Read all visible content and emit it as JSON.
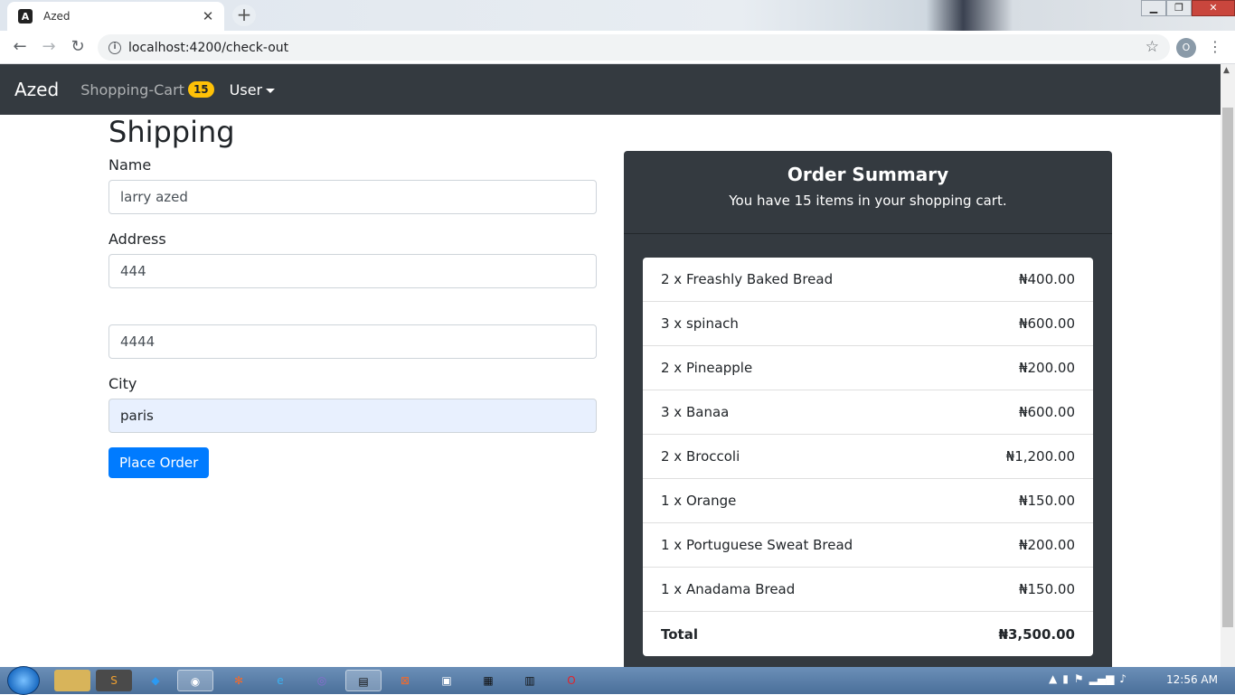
{
  "browser": {
    "tab_title": "Azed",
    "favicon_letter": "A",
    "tab_close": "✕",
    "new_tab": "+",
    "url": "localhost:4200/check-out",
    "profile_initial": "O"
  },
  "navbar": {
    "brand": "Azed",
    "cart_label": "Shopping-Cart",
    "cart_count": "15",
    "user_label": "User"
  },
  "form": {
    "heading": "Shipping",
    "name_label": "Name",
    "name_value": "larry azed",
    "address_label": "Address",
    "address_line1": "444",
    "address_line2": "4444",
    "city_label": "City",
    "city_value": "paris",
    "submit_label": "Place Order"
  },
  "summary": {
    "title": "Order Summary",
    "subtitle": "You have 15 items in your shopping cart.",
    "items": [
      {
        "label": "2 x Freashly Baked Bread",
        "price": "₦400.00"
      },
      {
        "label": "3 x spinach",
        "price": "₦600.00"
      },
      {
        "label": "2 x Pineapple",
        "price": "₦200.00"
      },
      {
        "label": "3 x Banaa",
        "price": "₦600.00"
      },
      {
        "label": "2 x Broccoli",
        "price": "₦1,200.00"
      },
      {
        "label": "1 x Orange",
        "price": "₦150.00"
      },
      {
        "label": "1 x Portuguese Sweat Bread",
        "price": "₦200.00"
      },
      {
        "label": "1 x Anadama Bread",
        "price": "₦150.00"
      }
    ],
    "total_label": "Total",
    "total_value": "₦3,500.00"
  },
  "taskbar": {
    "clock": "12:56 AM"
  },
  "colors": {
    "navbar_bg": "#343a40",
    "primary": "#007bff",
    "badge": "#ffc107"
  }
}
